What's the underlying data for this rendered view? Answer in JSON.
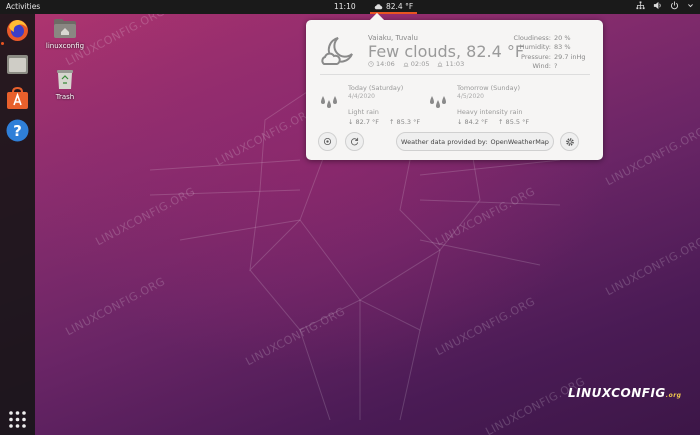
{
  "topbar": {
    "activities": "Activities",
    "clock": "11:10",
    "weather_temp": "82.4 °F"
  },
  "desktop_icons": [
    {
      "label": "linuxconfig"
    },
    {
      "label": "Trash"
    }
  ],
  "weather": {
    "location": "Vaiaku, Tuvalu",
    "summary": "Few clouds, 82.4 °F",
    "times": {
      "updated": "14:06",
      "sunrise": "02:05",
      "sunset": "11:03"
    },
    "details": [
      {
        "key": "Cloudiness:",
        "value": "20 %"
      },
      {
        "key": "Humidity:",
        "value": "83 %"
      },
      {
        "key": "Pressure:",
        "value": "29.7 inHg"
      },
      {
        "key": "Wind:",
        "value": "?"
      }
    ],
    "forecast": [
      {
        "day": "Today (Saturday)",
        "date": "4/4/2020",
        "condition": "Light rain",
        "low": "↓ 82.7 °F",
        "high": "↑ 85.3 °F"
      },
      {
        "day": "Tomorrow (Sunday)",
        "date": "4/5/2020",
        "condition": "Heavy intensity rain",
        "low": "↓ 84.2 °F",
        "high": "↑ 85.5 °F"
      }
    ],
    "provider_label": "Weather data provided by:",
    "provider_name": "OpenWeatherMap"
  },
  "watermark": "LINUXCONFIG.ORG",
  "brand": {
    "name": "LINUXCONFIG",
    "suffix": ".org"
  },
  "colors": {
    "accent": "#e95420",
    "panel": "#1a1a1a",
    "popup_bg": "#f6f5f4"
  }
}
